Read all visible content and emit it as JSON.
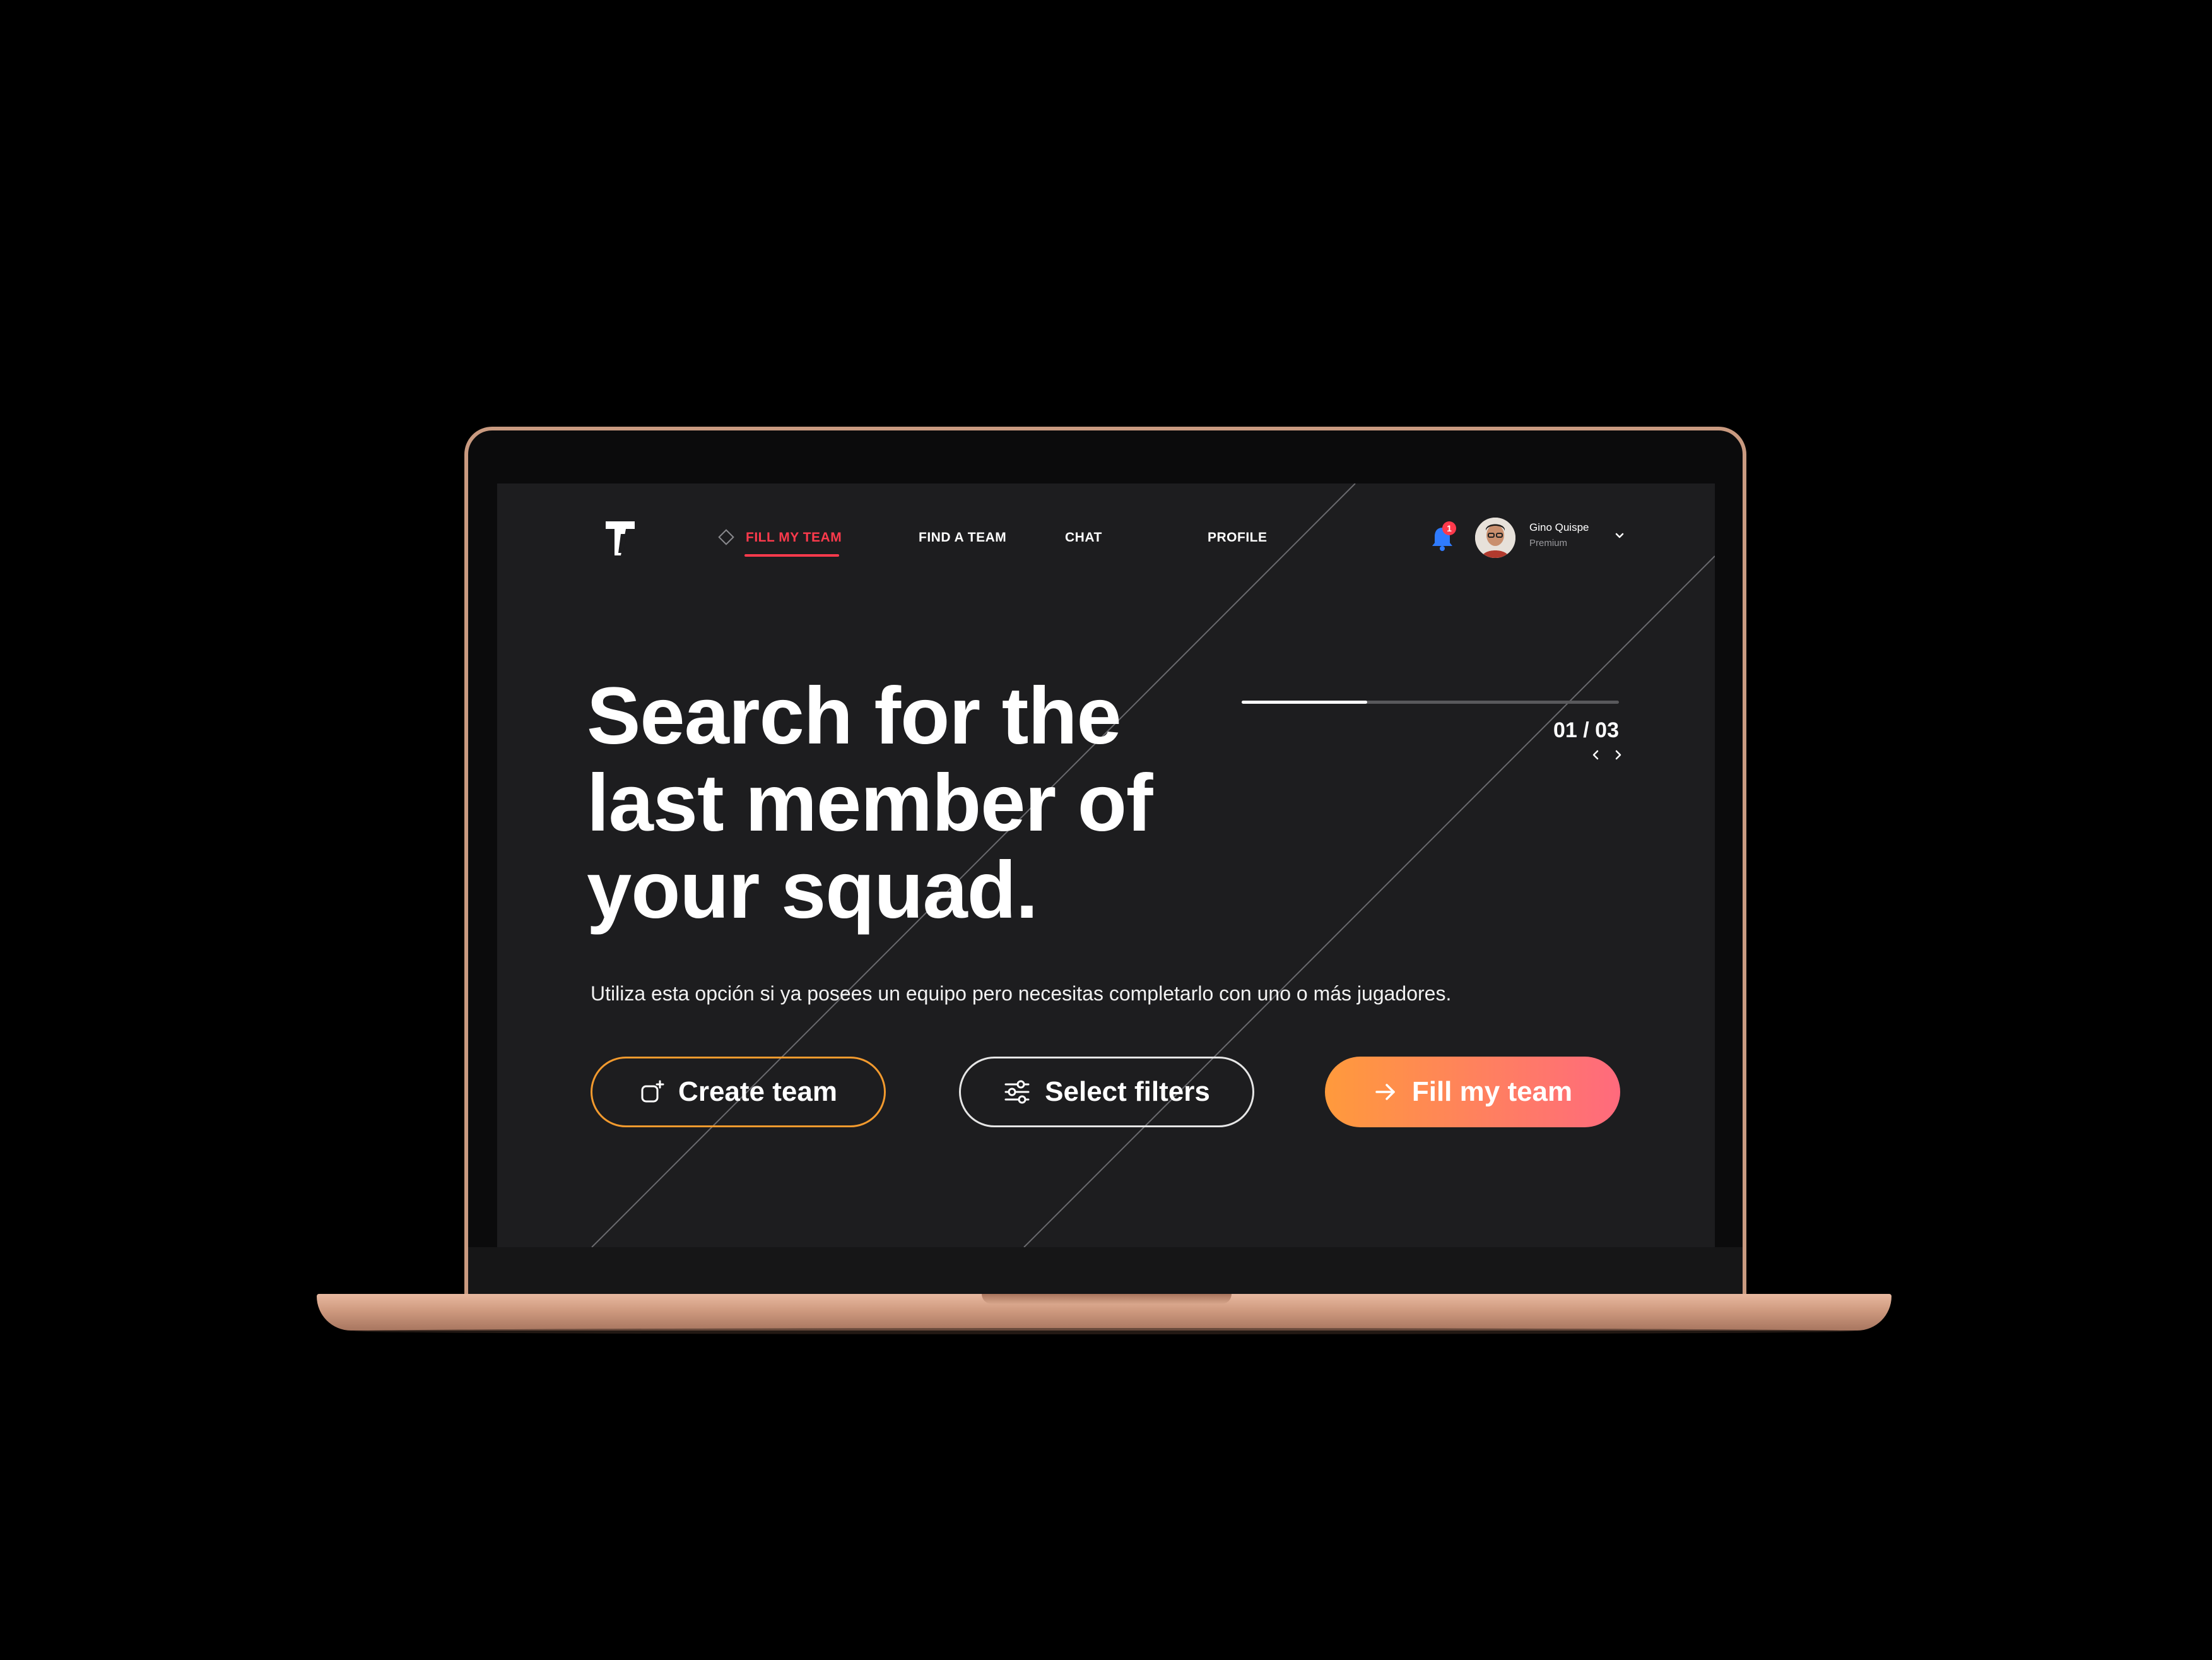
{
  "colors": {
    "accent": "#ff3a4c",
    "background": "#1d1d1f",
    "gradient_start": "#ff9a3c",
    "gradient_end": "#ff6a7d",
    "create_border": "#f29a2e",
    "bell": "#2f7bff"
  },
  "brand": {
    "logo_icon": "t-logo-icon"
  },
  "nav": {
    "items": [
      {
        "label": "FILL MY TEAM",
        "active": true
      },
      {
        "label": "FIND A TEAM",
        "active": false
      },
      {
        "label": "CHAT",
        "active": false
      },
      {
        "label": "PROFILE",
        "active": false
      }
    ]
  },
  "user": {
    "notification_count": "1",
    "name": "Gino Quispe",
    "plan": "Premium"
  },
  "hero": {
    "headline_line1": "Search for the",
    "headline_line2": "last member of",
    "headline_line3": "your squad.",
    "description": "Utiliza esta opción si ya posees un equipo pero necesitas completarlo con uno o más jugadores."
  },
  "slider": {
    "current": "01",
    "separator": "/",
    "total": "03",
    "progress": 0.333
  },
  "actions": {
    "create_label": "Create team",
    "filters_label": "Select filters",
    "fill_label": "Fill my team"
  }
}
